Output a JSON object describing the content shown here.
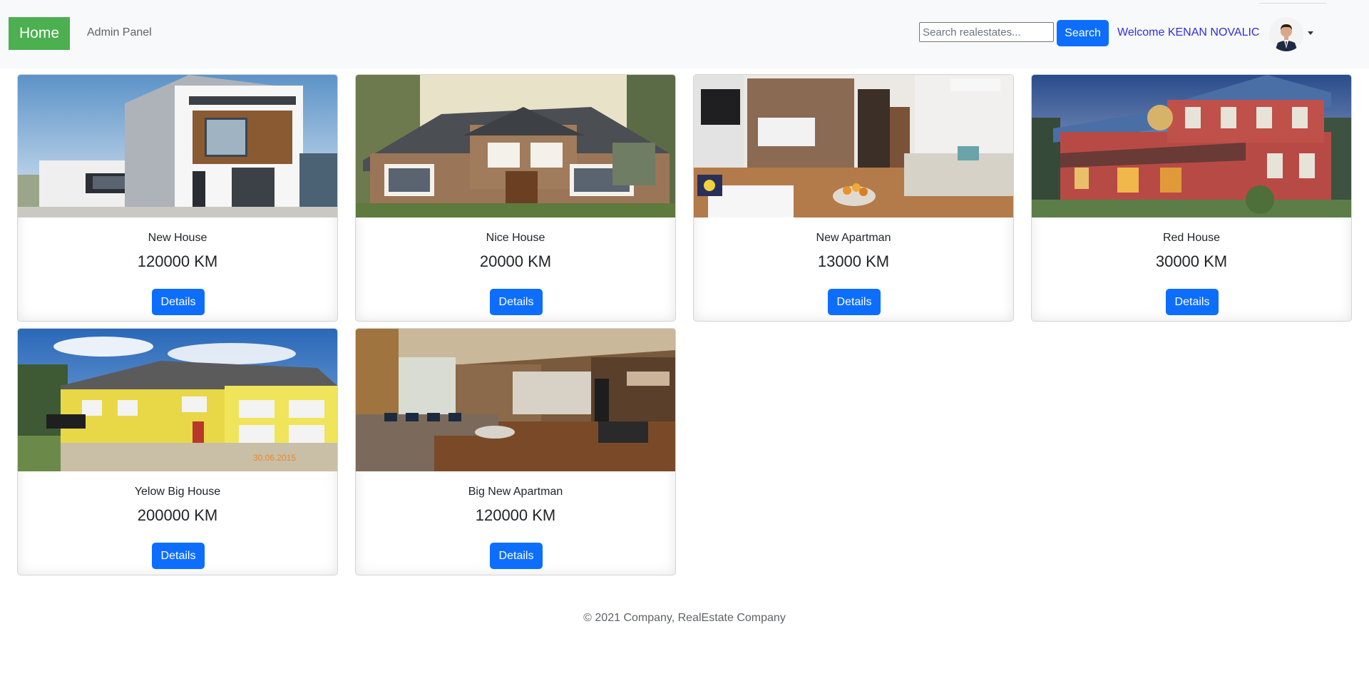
{
  "navbar": {
    "home_label": "Home",
    "admin_label": "Admin Panel",
    "search_placeholder": "Search realestates...",
    "search_value": "",
    "search_button_label": "Search",
    "welcome_text": "Welcome KENAN NOVALIC",
    "avatar_icon": "user-avatar-icon",
    "caret_icon": "caret-down-icon"
  },
  "listings": [
    {
      "title": "New House",
      "price": "120000 KM",
      "details_label": "Details",
      "image_icon": "modern-house-photo"
    },
    {
      "title": "Nice House",
      "price": "20000 KM",
      "details_label": "Details",
      "image_icon": "suburban-house-photo"
    },
    {
      "title": "New Apartman",
      "price": "13000 KM",
      "details_label": "Details",
      "image_icon": "apartment-interior-photo"
    },
    {
      "title": "Red House",
      "price": "30000 KM",
      "details_label": "Details",
      "image_icon": "red-house-photo"
    },
    {
      "title": "Yelow Big House",
      "price": "200000 KM",
      "details_label": "Details",
      "image_icon": "yellow-house-photo",
      "image_stamp": "30.06.2015"
    },
    {
      "title": "Big New Apartman",
      "price": "120000 KM",
      "details_label": "Details",
      "image_icon": "living-room-photo"
    }
  ],
  "footer": {
    "text": "© 2021 Company, RealEstate Company"
  },
  "colors": {
    "home_green": "#4caf50",
    "primary_blue": "#0d6efd",
    "welcome_blue": "#2e2ee6",
    "navbar_bg": "#f8f9fa"
  }
}
